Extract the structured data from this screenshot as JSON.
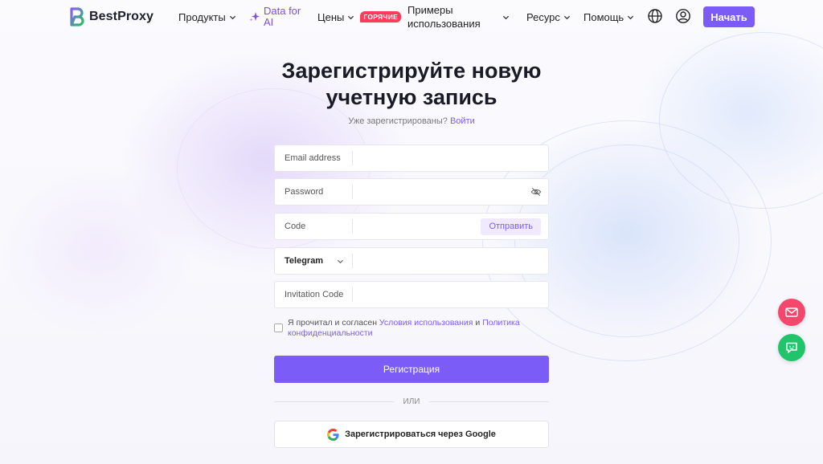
{
  "brand": {
    "name": "BestProxy"
  },
  "nav": {
    "products": "Продукты",
    "ai": "Data for AI",
    "prices": "Цены",
    "hot_badge": "ГОРЯЧИЕ",
    "use_cases": "Примеры использования",
    "resources": "Ресурс",
    "help": "Помощь",
    "start": "Начать"
  },
  "form": {
    "title": "Зарегистрируйте новую учетную запись",
    "already": "Уже зарегистрированы?",
    "login": "Войти",
    "email_label": "Email address",
    "password_label": "Password",
    "code_label": "Code",
    "send": "Отправить",
    "contact_select": "Telegram",
    "invitation_label": "Invitation Code",
    "agree_text": "Я прочитал и согласен",
    "terms": "Условия использования",
    "and": "и",
    "privacy": "Политика конфиденциальности",
    "register": "Регистрация",
    "or": "ИЛИ",
    "google": "Зарегистрироваться через Google"
  },
  "colors": {
    "accent": "#7c5cf6",
    "hot": "#ff3b5c",
    "mail_fab": "#f4476b",
    "chat_fab": "#22c46b"
  },
  "icons": [
    "globe-icon",
    "user-icon",
    "sparkle-icon",
    "eye-off-icon",
    "google-icon",
    "mail-icon",
    "chat-icon",
    "chevron-down-icon"
  ]
}
